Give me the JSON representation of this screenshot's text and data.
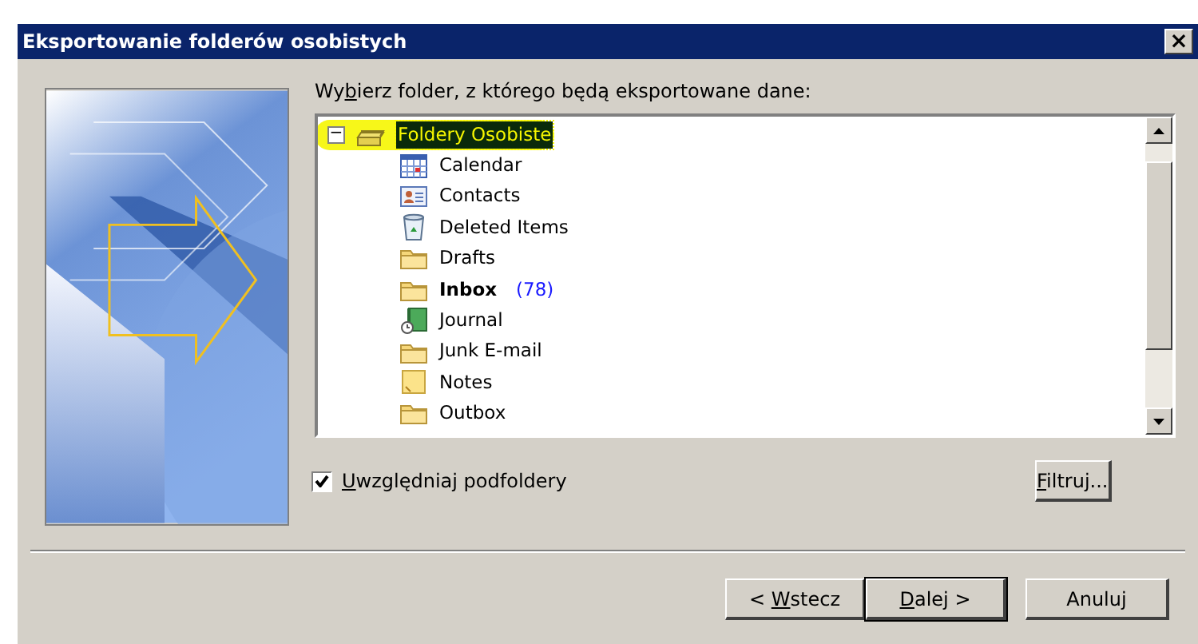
{
  "window": {
    "title": "Eksportowanie folderów osobistych",
    "close": "×"
  },
  "prompt": {
    "before": "Wy",
    "key": "b",
    "after": "ierz folder, z którego będą eksportowane dane:"
  },
  "tree": {
    "root": {
      "label": "Foldery Osobiste",
      "expanded": true,
      "selected": true,
      "toggle": "−"
    },
    "items": [
      {
        "kind": "calendar",
        "label": "Calendar",
        "selected": false
      },
      {
        "kind": "contacts",
        "label": "Contacts",
        "selected": false
      },
      {
        "kind": "deleted",
        "label": "Deleted Items",
        "selected": false
      },
      {
        "kind": "folder",
        "label": "Drafts",
        "selected": false
      },
      {
        "kind": "folder",
        "label": "Inbox",
        "unread": "(78)",
        "selected": false
      },
      {
        "kind": "journal",
        "label": "Journal",
        "selected": false
      },
      {
        "kind": "folder",
        "label": "Junk E-mail",
        "selected": false
      },
      {
        "kind": "notes",
        "label": "Notes",
        "selected": false
      },
      {
        "kind": "folder",
        "label": "Outbox",
        "selected": false
      }
    ]
  },
  "include_subfolders": {
    "label": {
      "key": "U",
      "after": "względniaj podfoldery"
    },
    "checked": true
  },
  "filter_button": {
    "key": "F",
    "after": "iltruj..."
  },
  "buttons": [
    {
      "label": {
        "before": "< ",
        "key": "W",
        "after": "stecz"
      },
      "default": false
    },
    {
      "label": {
        "key": "D",
        "after": "alej >"
      },
      "default": true
    },
    {
      "label": {
        "before": "Anuluj"
      },
      "default": false
    }
  ]
}
